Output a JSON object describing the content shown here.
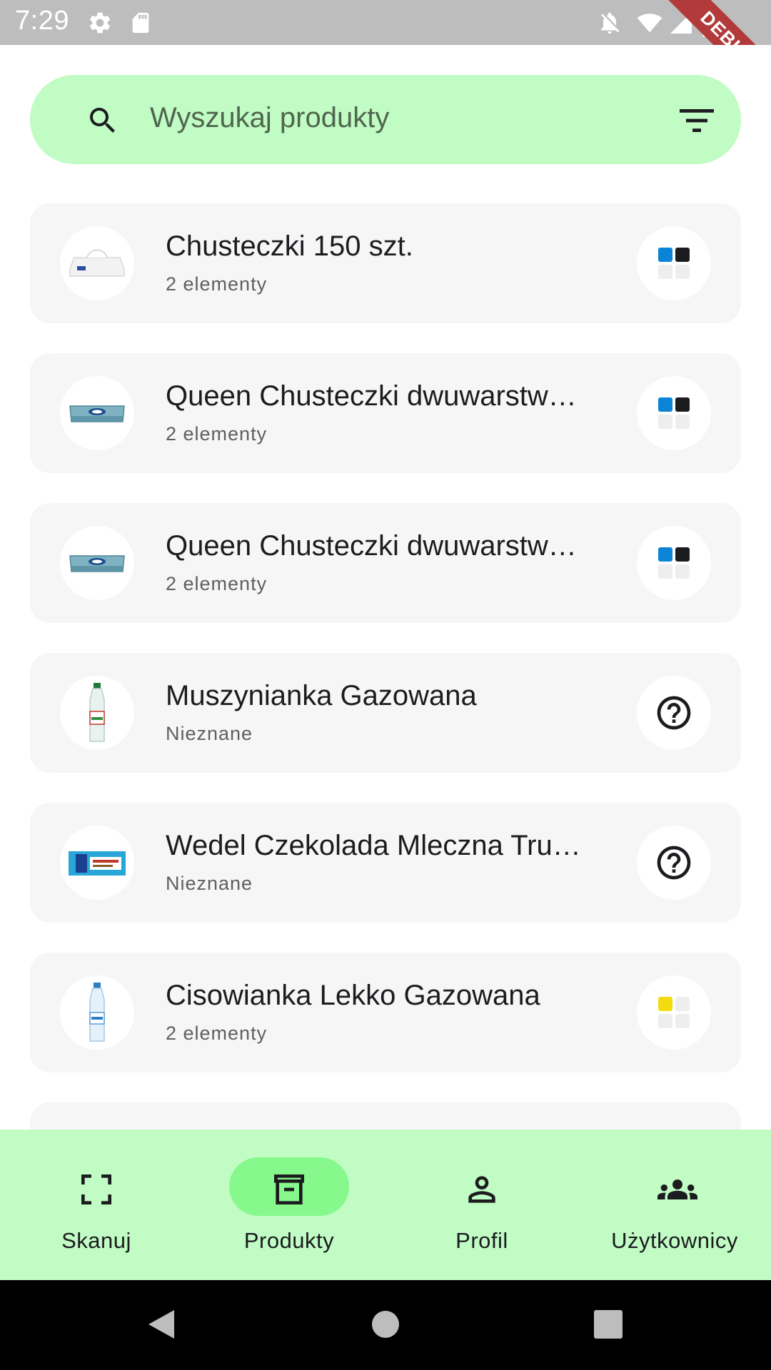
{
  "status_bar": {
    "time": "7:29",
    "left_icons": [
      "gear-icon",
      "sd-card-icon"
    ],
    "right_icons": [
      "notifications-off-icon",
      "wifi-icon",
      "signal-icon",
      "battery-icon"
    ],
    "debug_banner": "DEBUG"
  },
  "search": {
    "placeholder": "Wyszukaj produkty",
    "icon": "search-icon",
    "filter_icon": "filter-icon"
  },
  "products": [
    {
      "title": "Chusteczki 150 szt.",
      "subtitle": "2 elementy",
      "thumb": "tissue-box",
      "status": "tiles",
      "tiles": [
        "#0a84d6",
        "#1c1b1f",
        "#eeeeee",
        "#eeeeee"
      ]
    },
    {
      "title": "Queen Chusteczki dwuwarstw…",
      "subtitle": "2 elementy",
      "thumb": "tissue-box-blue",
      "status": "tiles",
      "tiles": [
        "#0a84d6",
        "#1c1b1f",
        "#eeeeee",
        "#eeeeee"
      ]
    },
    {
      "title": "Queen Chusteczki dwuwarstw…",
      "subtitle": "2 elementy",
      "thumb": "tissue-box-blue",
      "status": "tiles",
      "tiles": [
        "#0a84d6",
        "#1c1b1f",
        "#eeeeee",
        "#eeeeee"
      ]
    },
    {
      "title": "Muszynianka Gazowana",
      "subtitle": "Nieznane",
      "thumb": "water-bottle",
      "status": "unknown"
    },
    {
      "title": "Wedel Czekolada Mleczna Tru…",
      "subtitle": "Nieznane",
      "thumb": "chocolate-bar",
      "status": "unknown"
    },
    {
      "title": "Cisowianka Lekko Gazowana",
      "subtitle": "2 elementy",
      "thumb": "water-bottle-blue",
      "status": "tiles",
      "tiles": [
        "#f2dc10",
        "#eeeeee",
        "#eeeeee",
        "#eeeeee"
      ]
    }
  ],
  "bottom_nav": [
    {
      "label": "Skanuj",
      "icon": "scan-icon",
      "active": false
    },
    {
      "label": "Produkty",
      "icon": "archive-icon",
      "active": true
    },
    {
      "label": "Profil",
      "icon": "person-icon",
      "active": false
    },
    {
      "label": "Użytkownicy",
      "icon": "group-icon",
      "active": false
    }
  ],
  "colors": {
    "accent": "#c0fcc4",
    "accent_active": "#86f88c",
    "card": "#f6f6f6"
  }
}
